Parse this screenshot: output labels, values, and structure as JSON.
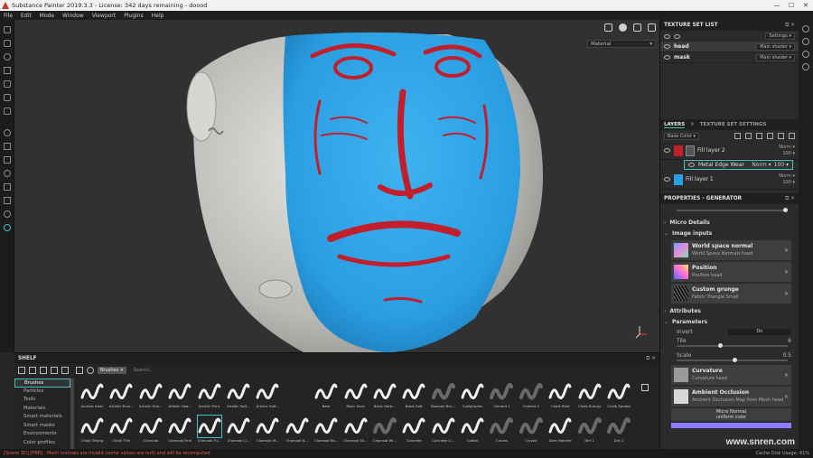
{
  "window": {
    "title": "Substance Painter 2019.3.3 - License: 342 days remaining - doood",
    "min_glyph": "—",
    "max_glyph": "☐",
    "close_glyph": "✕"
  },
  "menu": [
    "File",
    "Edit",
    "Mode",
    "Window",
    "Viewport",
    "Plugins",
    "Help"
  ],
  "viewport": {
    "material_select": "Material",
    "icons": [
      "camera-icon",
      "sphere-icon",
      "video-icon",
      "screenshot-icon"
    ]
  },
  "texture_set_list": {
    "title": "TEXTURE SET LIST",
    "settings_label": "Settings ▾",
    "sets": [
      {
        "name": "head",
        "shader": "Main shader ▾"
      },
      {
        "name": "mask",
        "shader": "Main shader ▾"
      }
    ]
  },
  "layers": {
    "tab_layers": "LAYERS",
    "tab_tss": "TEXTURE SET SETTINGS",
    "channel": "Base Color ▾",
    "items": [
      {
        "name": "Fill layer 2",
        "blend": "Norm ▾",
        "opacity": "100 ▾"
      },
      {
        "name": "Fill layer 1",
        "blend": "Norm ▾",
        "opacity": "100 ▾"
      }
    ],
    "sub": {
      "name": "Metal Edge Wear",
      "blend": "Norm ▾",
      "opacity": "100 ▾"
    }
  },
  "properties": {
    "title": "PROPERTIES - GENERATOR",
    "micro_details": "Micro Details",
    "image_inputs": "Image inputs",
    "inputs": [
      {
        "title": "World space normal",
        "sub": "World Space Normals head",
        "icon": "normal-map-icon"
      },
      {
        "title": "Position",
        "sub": "Position head",
        "icon": "position-map-icon"
      },
      {
        "title": "Custom grunge",
        "sub": "Fabric Triangle Small",
        "icon": "grunge-icon"
      }
    ],
    "attributes": "Attributes",
    "parameters": "Parameters",
    "invert_label": "Invert",
    "invert_value": "On",
    "tile_label": "Tile",
    "tile_value": "6",
    "tile_fraction": 0.37,
    "scale_label": "Scale",
    "scale_value": "0.5",
    "scale_fraction": 0.5,
    "curvature": {
      "title": "Curvature",
      "sub": "Curvature head"
    },
    "ao": {
      "title": "Ambient Occlusion",
      "sub": "Ambient Occlusion Map from Mesh head"
    },
    "micro_normal_label": "Micro Normal",
    "micro_normal_sub": "uniform color"
  },
  "shelf": {
    "title": "SHELF",
    "filter_chip": "Brushes ✕",
    "search_placeholder": "Search...",
    "categories": [
      "Brushes",
      "Particles",
      "Tools",
      "Materials",
      "Smart materials",
      "Smart masks",
      "Environments",
      "Color profiles"
    ],
    "brushes": [
      "Archive Inker",
      "Artistic Brus...",
      "Artistic Hair...",
      "Artistic Hea...",
      "Artistic Print",
      "Artistic Soft...",
      "Artistic Soft...",
      "",
      "Bark",
      "Basic Hard",
      "Basic Hard...",
      "Basic Soft",
      "Basmati Bru...",
      "Calligraphic",
      "Cement 1",
      "Cement 2",
      "Chalk Bold",
      "Chalk Bumpy",
      "Chalk Spread",
      "Chalk Strong",
      "Chalk Thin",
      "Charcoal",
      "Charcoal Fine",
      "Charcoal Fu...",
      "Charcoal Li...",
      "Charcoal M...",
      "Charcoal N...",
      "Charcoal Ra...",
      "Charcoal Sh...",
      "Charcoal Wi...",
      "Concrete",
      "Concrete Li...",
      "Cotton",
      "Cracks",
      "Crystal",
      "Dark Hatcher",
      "Dirt 1",
      "Dirt 2"
    ]
  },
  "status": {
    "error": "[Scene 3D] [PBR] : Mesh normals are invalid (some values are null) and will be recomputed",
    "right": "Cache Disk Usage:  41%"
  },
  "watermark": "www.snren.com"
}
